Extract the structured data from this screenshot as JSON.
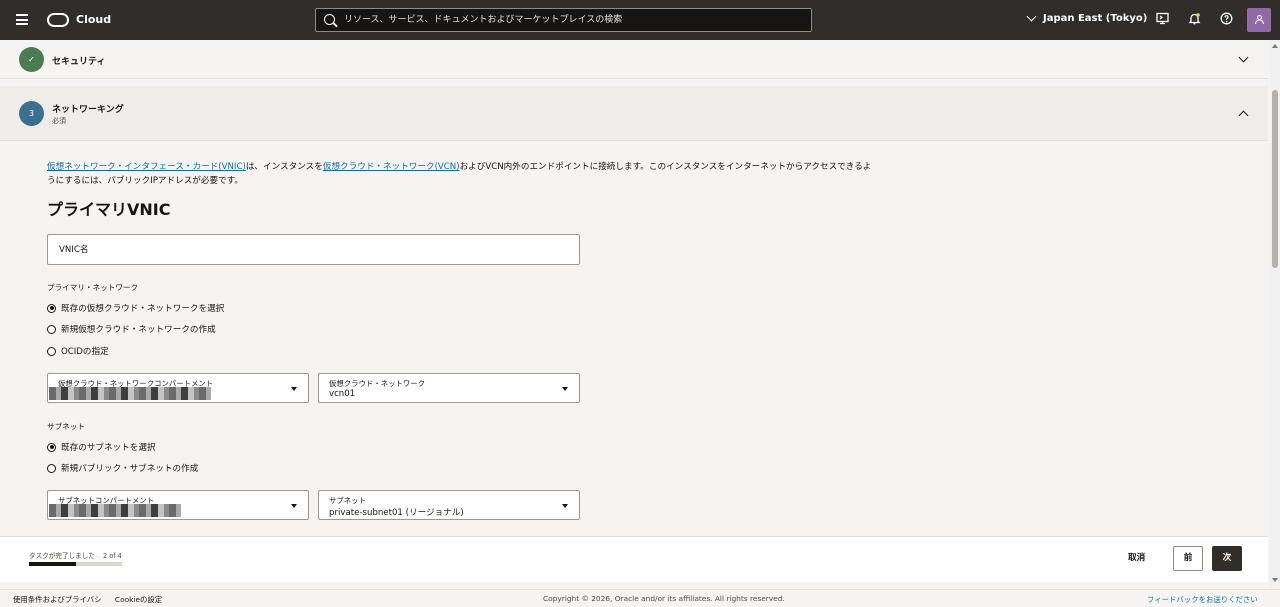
{
  "topbar": {
    "brand": "Cloud",
    "search_placeholder": "リソース、サービス、ドキュメントおよびマーケットプレイスの検索",
    "region": "Japan East (Tokyo)"
  },
  "steps": {
    "security": {
      "title": "セキュリティ",
      "badge": "✓"
    },
    "networking": {
      "title": "ネットワーキング",
      "badge": "3",
      "subtitle": "必須"
    }
  },
  "intro": {
    "link1": "仮想ネットワーク・インタフェース・カード(VNIC)",
    "text1": "は、インスタンスを",
    "link2": "仮想クラウド・ネットワーク(VCN)",
    "text2": "およびVCN内外のエンドポイントに接続します。このインスタンスをインターネットからアクセスできるようにするには、パブリックIPアドレスが必要です。"
  },
  "primary_vnic": {
    "heading": "プライマリVNIC",
    "name_placeholder": "VNIC名"
  },
  "network": {
    "label": "プライマリ・ネットワーク",
    "options": [
      "既存の仮想クラウド・ネットワークを選択",
      "新規仮想クラウド・ネットワークの作成",
      "OCIDの指定"
    ],
    "compartment_label": "仮想クラウド・ネットワークコンパートメント",
    "vcn_label": "仮想クラウド・ネットワーク",
    "vcn_value": "vcn01"
  },
  "subnet": {
    "label": "サブネット",
    "options": [
      "既存のサブネットを選択",
      "新規パブリック・サブネットの作成"
    ],
    "compartment_label": "サブネットコンパートメント",
    "subnet_label": "サブネット",
    "subnet_value": "private-subnet01 (リージョナル)"
  },
  "actionbar": {
    "task_label": "タスクが完了しました",
    "task_count": "2 of 4",
    "progress": 0.5,
    "cancel": "取消",
    "prev": "前",
    "next": "次"
  },
  "footer": {
    "terms": "使用条件およびプライバシ",
    "cookie": "Cookieの設定",
    "copyright": "Copyright © 2026, Oracle and/or its affiliates. All rights reserved.",
    "feedback": "フィードバックをお送りください"
  }
}
